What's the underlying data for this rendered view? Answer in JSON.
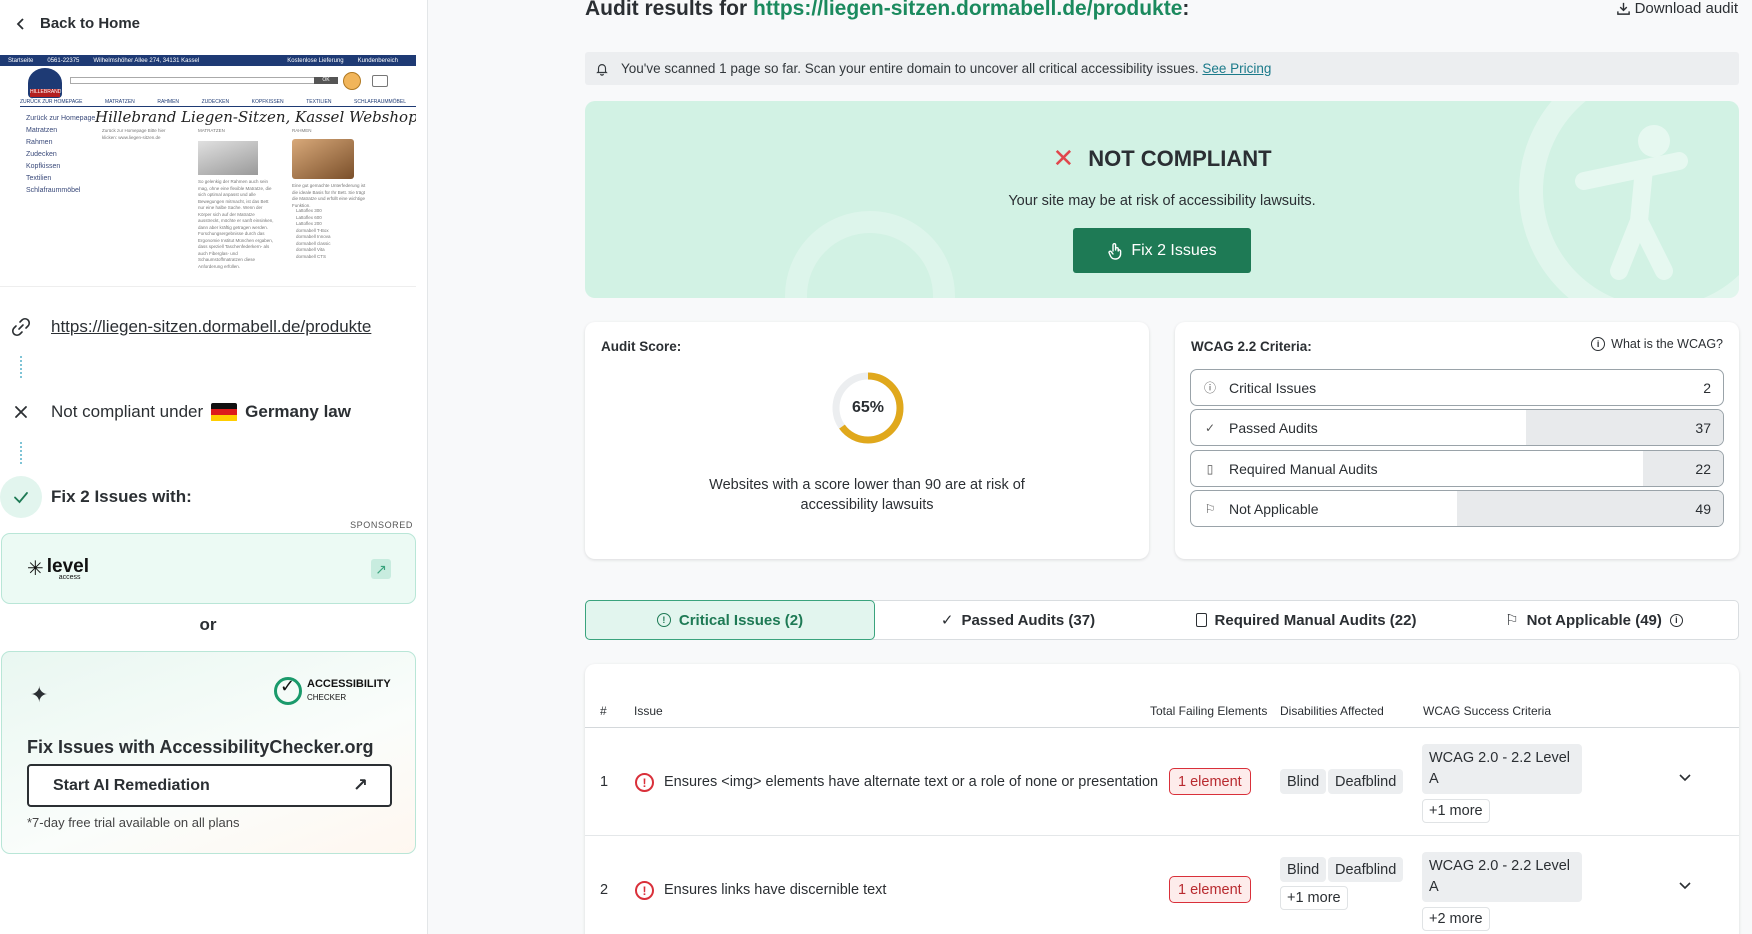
{
  "sidebar": {
    "back_label": "Back to Home",
    "thumbnail": {
      "site_title": "Hillebrand Liegen-Sitzen, Kassel Webshop",
      "topbar": [
        "Startseite",
        "0561-22375",
        "Wilhelmshöher Allee 274, 34131 Kassel",
        "Kostenlose Lieferung",
        "Kundenbereich"
      ],
      "logo_text": "HILLEBRAND",
      "ok_label": "OK",
      "nav": [
        "ZURÜCK ZUR HOMEPAGE",
        "MATRATZEN",
        "RAHMEN",
        "ZUDECKEN",
        "KOPFKISSEN",
        "TEXTILIEN",
        "SCHLAFRAUMMÖBEL"
      ],
      "menu": [
        "Zurück zur Homepage",
        "Matratzen",
        "Rahmen",
        "Zudecken",
        "Kopfkissen",
        "Textilien",
        "Schlafraummöbel"
      ],
      "col_back": "Zurück zur Homepage Bitte hier klicken: www.liegen-sitzen.de",
      "col1_head": "MATRATZEN",
      "col1_text": "So gelenkig der Rahmen auch sein mag, ohne eine flexible Matratze, die sich optimal anpasst und alle Bewegungen mitmacht, ist das Bett nur eine halbe Sache. Wenn der Körper sich auf der Matratze ausstreckt, möchte er sanft einsinken, dann aber kräftig getragen werden. Forschungsergebnisse durch das Ergonomie Institut München ergaben, dass speziell Taschenfederkern- als auch Fiberglas- und Schaumstoffmatratzen diese Anforderung erfüllen.",
      "col2_head": "RAHMEN",
      "col2_text": "Eine gut gemachte Unterfederung ist die ideale Basis für Ihr Bett. Sie trägt die Matratze und erfüllt eine wichtige Funktion.",
      "col2_list": [
        "Lattoflex 300",
        "Lattoflex 600",
        "Lattoflex 200",
        "dormabell T-Box",
        "dormabell Innova",
        "dormabell classic",
        "dormabell Vita",
        "dormabell CTS"
      ]
    },
    "url": "https://liegen-sitzen.dormabell.de/produkte",
    "compliance_prefix": "Not compliant under",
    "compliance_law": "Germany law",
    "fix_label": "Fix 2 Issues with:",
    "sponsored": "SPONSORED",
    "level_logo": "level",
    "level_logo_sub": "access",
    "or_label": "or",
    "ac_logo_title": "ACCESSIBILITY",
    "ac_logo_sub": "CHECKER",
    "ac_title": "Fix Issues with AccessibilityChecker.org",
    "ac_button": "Start AI Remediation",
    "ac_note": "*7-day free trial available on all plans"
  },
  "header": {
    "title_prefix": "Audit results for",
    "title_url": "https://liegen-sitzen.dormabell.de/produkte",
    "title_suffix": ":",
    "download": "Download audit"
  },
  "notice": {
    "text": "You've scanned 1 page so far. Scan your entire domain to uncover all critical accessibility issues.",
    "link": "See Pricing"
  },
  "status": {
    "title": "NOT COMPLIANT",
    "subtitle": "Your site may be at risk of accessibility lawsuits.",
    "button": "Fix 2 Issues"
  },
  "score": {
    "label": "Audit Score:",
    "value": 65,
    "value_text": "65%",
    "note": "Websites with a score lower than 90 are at risk of accessibility lawsuits",
    "colors": {
      "arc": "#e0a81c",
      "track": "#eceef0"
    }
  },
  "wcag": {
    "label": "WCAG 2.2 Criteria:",
    "help": "What is the WCAG?",
    "rows": [
      {
        "icon": "alert-circle-icon",
        "label": "Critical Issues",
        "count": "2",
        "fill": 0
      },
      {
        "icon": "check-icon",
        "label": "Passed Audits",
        "count": "37",
        "fill": 0.37
      },
      {
        "icon": "document-icon",
        "label": "Required Manual Audits",
        "count": "22",
        "fill": 0.15
      },
      {
        "icon": "flag-icon",
        "label": "Not Applicable",
        "count": "49",
        "fill": 0.5
      }
    ]
  },
  "tabs": [
    {
      "label": "Critical Issues (2)",
      "icon": "alert-circle-icon",
      "active": true
    },
    {
      "label": "Passed Audits (37)",
      "icon": "check-icon",
      "active": false
    },
    {
      "label": "Required Manual Audits (22)",
      "icon": "document-icon",
      "active": false
    },
    {
      "label": "Not Applicable (49)",
      "icon": "flag-icon",
      "active": false
    }
  ],
  "table": {
    "headers": [
      "#",
      "Issue",
      "Total Failing Elements",
      "Disabilities Affected",
      "WCAG Success Criteria"
    ],
    "rows": [
      {
        "num": "1",
        "issue": "Ensures <img> elements have alternate text or a role of none or presentation",
        "elements": "1 element",
        "disabilities": [
          "Blind",
          "Deafblind"
        ],
        "disabilities_more": "",
        "wcag": "WCAG 2.0 - 2.2 Level A",
        "wcag_more": "+1 more"
      },
      {
        "num": "2",
        "issue": "Ensures links have discernible text",
        "elements": "1 element",
        "disabilities": [
          "Blind",
          "Deafblind"
        ],
        "disabilities_more": "+1 more",
        "wcag": "WCAG 2.0 - 2.2 Level A",
        "wcag_more": "+2 more"
      }
    ]
  },
  "colors": {
    "accent": "#1e7a55",
    "link": "#1b8a5e",
    "error": "#d9303a",
    "status_bg": "#d2f2e4"
  }
}
